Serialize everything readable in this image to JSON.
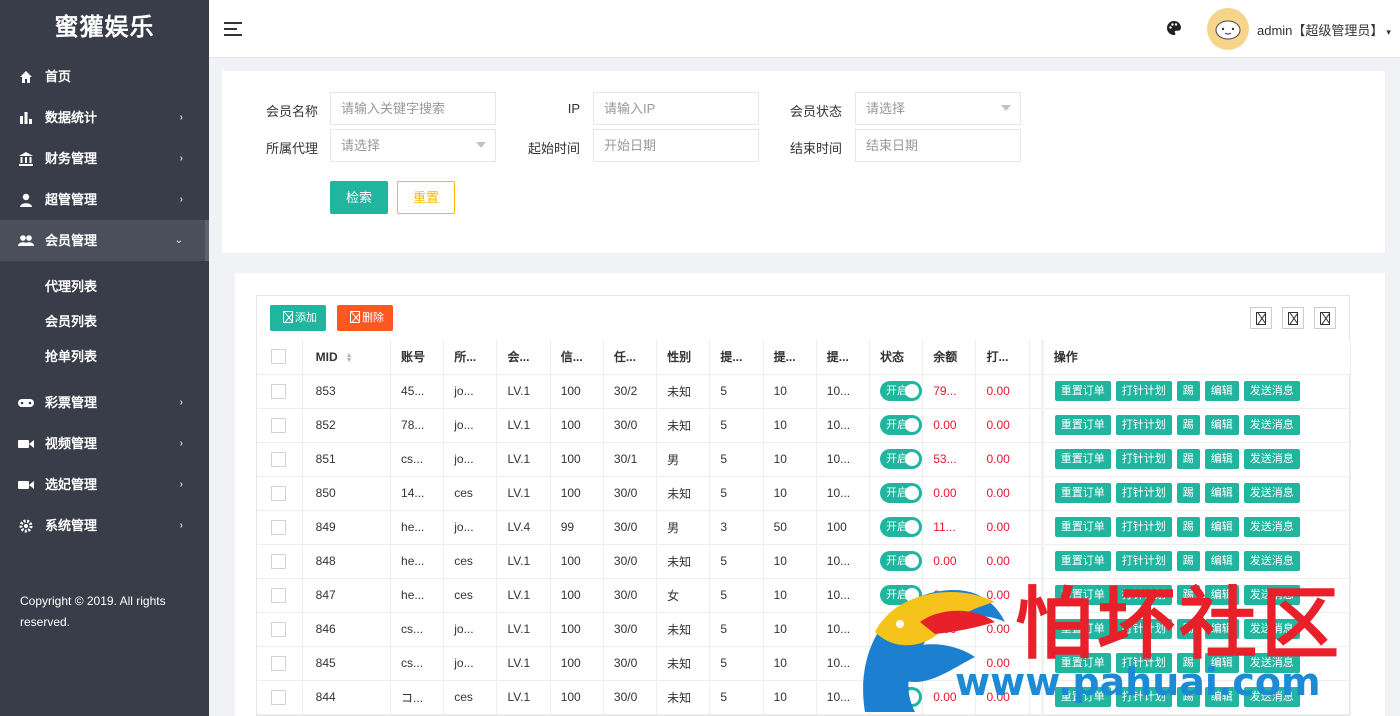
{
  "sidebar": {
    "brand": "蜜獾娱乐",
    "menu": [
      {
        "label": "首页",
        "icon": "home-icon",
        "chevron": ""
      },
      {
        "label": "数据统计",
        "icon": "bar-chart-icon",
        "chevron": "›"
      },
      {
        "label": "财务管理",
        "icon": "bank-icon",
        "chevron": "›"
      },
      {
        "label": "超管管理",
        "icon": "user-icon",
        "chevron": "›"
      },
      {
        "label": "会员管理",
        "icon": "users-icon",
        "chevron": "⌄"
      }
    ],
    "submenu": [
      "代理列表",
      "会员列表",
      "抢单列表"
    ],
    "menu2": [
      {
        "label": "彩票管理",
        "icon": "gamepad-icon",
        "chevron": "›"
      },
      {
        "label": "视频管理",
        "icon": "video-icon",
        "chevron": "›"
      },
      {
        "label": "选妃管理",
        "icon": "video-icon",
        "chevron": "›"
      },
      {
        "label": "系统管理",
        "icon": "gear-icon",
        "chevron": "›"
      }
    ],
    "copyright": "Copyright © 2019. All rights reserved."
  },
  "header": {
    "user": "admin【超级管理员】",
    "caret": "▾"
  },
  "search": {
    "member_name_label": "会员名称",
    "member_name_placeholder": "请输入关键字搜索",
    "ip_label": "IP",
    "ip_placeholder": "请输入IP",
    "status_label": "会员状态",
    "status_value": "请选择",
    "agent_label": "所属代理",
    "agent_value": "请选择",
    "start_label": "起始时间",
    "start_placeholder": "开始日期",
    "end_label": "结束时间",
    "end_placeholder": "结束日期",
    "search_button": "检索",
    "reset_button": "重置"
  },
  "toolbar": {
    "add": "添加",
    "delete": "删除"
  },
  "table": {
    "headers": [
      "MID",
      "账号",
      "所...",
      "会...",
      "信...",
      "任...",
      "性别",
      "提...",
      "提...",
      "提...",
      "状态",
      "余额",
      "打...",
      "操作"
    ],
    "actions": [
      "重置订单",
      "打针计划",
      "踢",
      "编辑",
      "发送消息"
    ],
    "toggle_label": "开启",
    "rows": [
      [
        "853",
        "45...",
        "jo...",
        "LV.1",
        "100",
        "30/2",
        "未知",
        "5",
        "10",
        "10...",
        "79...",
        "0.00"
      ],
      [
        "852",
        "78...",
        "jo...",
        "LV.1",
        "100",
        "30/0",
        "未知",
        "5",
        "10",
        "10...",
        "0.00",
        "0.00"
      ],
      [
        "851",
        "cs...",
        "jo...",
        "LV.1",
        "100",
        "30/1",
        "男",
        "5",
        "10",
        "10...",
        "53...",
        "0.00"
      ],
      [
        "850",
        "14...",
        "ces",
        "LV.1",
        "100",
        "30/0",
        "未知",
        "5",
        "10",
        "10...",
        "0.00",
        "0.00"
      ],
      [
        "849",
        "he...",
        "jo...",
        "LV.4",
        "99",
        "30/0",
        "男",
        "3",
        "50",
        "100",
        "11...",
        "0.00"
      ],
      [
        "848",
        "he...",
        "ces",
        "LV.1",
        "100",
        "30/0",
        "未知",
        "5",
        "10",
        "10...",
        "0.00",
        "0.00"
      ],
      [
        "847",
        "he...",
        "ces",
        "LV.1",
        "100",
        "30/0",
        "女",
        "5",
        "10",
        "10...",
        "0.00",
        "0.00"
      ],
      [
        "846",
        "cs...",
        "jo...",
        "LV.1",
        "100",
        "30/0",
        "未知",
        "5",
        "10",
        "10...",
        "0.00",
        "0.00"
      ],
      [
        "845",
        "cs...",
        "jo...",
        "LV.1",
        "100",
        "30/0",
        "未知",
        "5",
        "10",
        "10...",
        "0.00",
        "0.00"
      ],
      [
        "844",
        "コ...",
        "ces",
        "LV.1",
        "100",
        "30/0",
        "未知",
        "5",
        "10",
        "10...",
        "0.00",
        "0.00"
      ]
    ]
  },
  "watermark": {
    "text": "怕坏社区",
    "url": "www.pahuai.com"
  }
}
